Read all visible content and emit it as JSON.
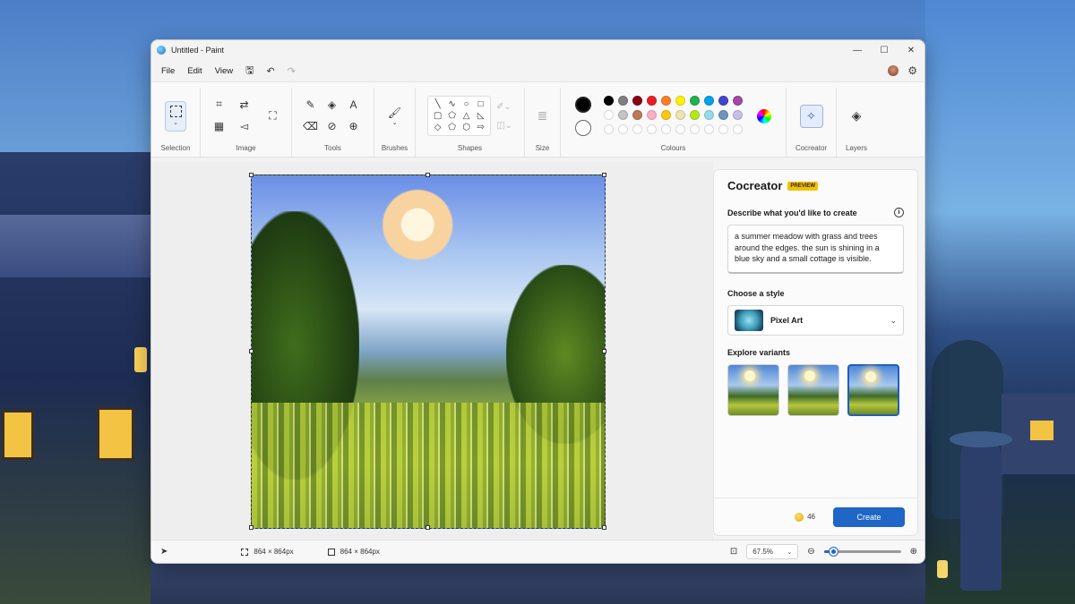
{
  "window": {
    "title": "Untitled - Paint",
    "minimize": "—",
    "maximize": "☐",
    "close": "✕"
  },
  "menu": {
    "file": "File",
    "edit": "Edit",
    "view": "View"
  },
  "ribbon": {
    "selection": "Selection",
    "image": "Image",
    "tools": "Tools",
    "brushes": "Brushes",
    "shapes": "Shapes",
    "size": "Size",
    "colours": "Colours",
    "cocreator": "Cocreator",
    "layers": "Layers"
  },
  "colors": {
    "primary": "#000000",
    "secondary": "#ffffff",
    "palette": [
      "#000000",
      "#7f7f7f",
      "#880015",
      "#ed1c24",
      "#ff7f27",
      "#fff200",
      "#22b14c",
      "#00a2e8",
      "#3f48cc",
      "#a349a4",
      "#ffffff",
      "#c3c3c3",
      "#b97a57",
      "#ffaec9",
      "#ffc90e",
      "#efe4b0",
      "#b5e61d",
      "#99d9ea",
      "#7092be",
      "#c8bfe7",
      "#ffffff",
      "#ffffff",
      "#ffffff",
      "#ffffff",
      "#ffffff",
      "#ffffff",
      "#ffffff",
      "#ffffff",
      "#ffffff",
      "#ffffff"
    ],
    "accent": "#1f66c6"
  },
  "panel": {
    "title": "Cocreator",
    "badge": "PREVIEW",
    "describe_label": "Describe what you'd like to create",
    "prompt": "a summer meadow with grass and trees around the edges. the sun is shining in a blue sky and a small cottage is visible.",
    "style_label": "Choose a style",
    "style_value": "Pixel Art",
    "variants_label": "Explore variants",
    "credits": "46",
    "create": "Create"
  },
  "status": {
    "selection_size": "864 × 864px",
    "canvas_size": "864 × 864px",
    "zoom": "67.5%",
    "zoom_slider_fraction": 0.12
  }
}
